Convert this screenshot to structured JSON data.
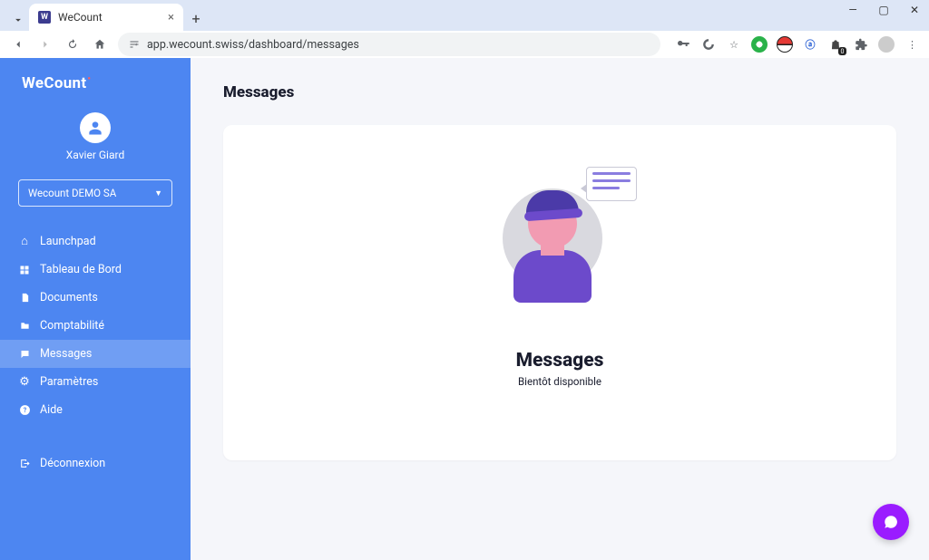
{
  "browser": {
    "tab_title": "WeCount",
    "url": "app.wecount.swiss/dashboard/messages",
    "favicon_letter": "W"
  },
  "app": {
    "logo_text": "WeCount",
    "user_name": "Xavier Giard",
    "company_selected": "Wecount DEMO SA"
  },
  "nav": {
    "items": [
      {
        "label": "Launchpad",
        "icon": "home-icon",
        "active": false
      },
      {
        "label": "Tableau de Bord",
        "icon": "dashboard-icon",
        "active": false
      },
      {
        "label": "Documents",
        "icon": "document-icon",
        "active": false
      },
      {
        "label": "Comptabilité",
        "icon": "folder-icon",
        "active": false
      },
      {
        "label": "Messages",
        "icon": "chat-icon",
        "active": true
      },
      {
        "label": "Paramètres",
        "icon": "gear-icon",
        "active": false
      },
      {
        "label": "Aide",
        "icon": "help-icon",
        "active": false
      }
    ],
    "logout_label": "Déconnexion"
  },
  "page": {
    "title": "Messages",
    "empty_heading": "Messages",
    "empty_subtext": "Bientôt disponible"
  }
}
